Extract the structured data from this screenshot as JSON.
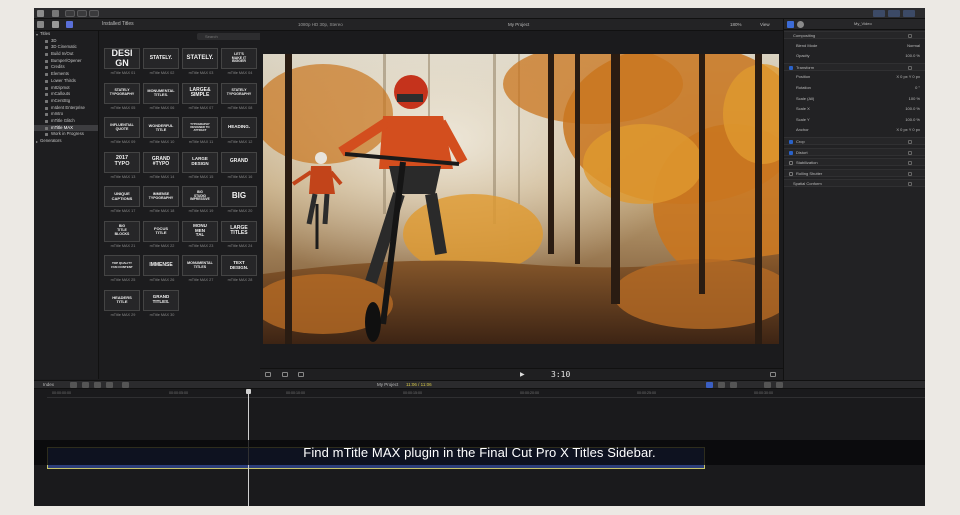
{
  "toolbar": {
    "icons": [
      "film-strip-icon",
      "key-icon",
      "titles-icon",
      "share-icon"
    ]
  },
  "browser": {
    "library_title": "Installed Titles",
    "search_placeholder": "Search",
    "sidebar": [
      {
        "label": "Titles",
        "expanded": true,
        "selected": false
      },
      {
        "label": "3D",
        "selected": false
      },
      {
        "label": "3D Cinematic",
        "selected": false
      },
      {
        "label": "Build In/Out",
        "selected": false
      },
      {
        "label": "Bumper/Opener",
        "selected": false
      },
      {
        "label": "Credits",
        "selected": false
      },
      {
        "label": "Elements",
        "selected": false
      },
      {
        "label": "Lower Thirds",
        "selected": false
      },
      {
        "label": "m8zipmot",
        "selected": false
      },
      {
        "label": "mCallouts",
        "selected": false
      },
      {
        "label": "mCentStg",
        "selected": false
      },
      {
        "label": "mIdent Enterprise",
        "selected": false
      },
      {
        "label": "mIntro",
        "selected": false
      },
      {
        "label": "mTitle Glitch",
        "selected": false
      },
      {
        "label": "mTitle MAX",
        "selected": true
      },
      {
        "label": "Work in Progress",
        "selected": false
      },
      {
        "label": "Generators",
        "expanded": false,
        "selected": false
      }
    ],
    "titles": [
      {
        "thumb": "DESI\nGN",
        "caption": "mTitle MAX 01"
      },
      {
        "thumb": "STATELY.",
        "caption": "mTitle MAX 02"
      },
      {
        "thumb": "STATELY.",
        "caption": "mTitle MAX 03"
      },
      {
        "thumb": "LET'S\nMAKE IT\nBIGGER",
        "caption": "mTitle MAX 04"
      },
      {
        "thumb": "STATELY\nTYPOGRAPHY",
        "caption": "mTitle MAX 05"
      },
      {
        "thumb": "MONUMENTAL\nTITLES.",
        "caption": "mTitle MAX 06"
      },
      {
        "thumb": "LARGE&\nSIMPLE",
        "caption": "mTitle MAX 07"
      },
      {
        "thumb": "STATELY\nTYPOGRAPHY",
        "caption": "mTitle MAX 08"
      },
      {
        "thumb": "INFLUENTIAL\nQUOTE",
        "caption": "mTitle MAX 09"
      },
      {
        "thumb": "WONDERFUL\nTITLE",
        "caption": "mTitle MAX 10"
      },
      {
        "thumb": "TYPOGRAPHY\nDESIGNED TO\nATTRACT",
        "caption": "mTitle MAX 11"
      },
      {
        "thumb": "HEADING.",
        "caption": "mTitle MAX 12"
      },
      {
        "thumb": "2017\nTYPO",
        "caption": "mTitle MAX 13"
      },
      {
        "thumb": "GRAND\n#TYPO",
        "caption": "mTitle MAX 14"
      },
      {
        "thumb": "LARGE\nDESIGN",
        "caption": "mTitle MAX 15"
      },
      {
        "thumb": "GRAND",
        "caption": "mTitle MAX 16"
      },
      {
        "thumb": "UNIQUE\nCAPTIONS",
        "caption": "mTitle MAX 17"
      },
      {
        "thumb": "IMMENSE\nTYPOGRAPHY",
        "caption": "mTitle MAX 18"
      },
      {
        "thumb": "BIG\nSTUDIO\nIMPRESSIVE",
        "caption": "mTitle MAX 19"
      },
      {
        "thumb": "BIG",
        "caption": "mTitle MAX 20"
      },
      {
        "thumb": "BIG\nTITLE\nBLOCKS",
        "caption": "mTitle MAX 21"
      },
      {
        "thumb": "FOCUS\nTITLE",
        "caption": "mTitle MAX 22"
      },
      {
        "thumb": "MONU\nMEN\nTAL",
        "caption": "mTitle MAX 23"
      },
      {
        "thumb": "LARGE\nTITLES",
        "caption": "mTitle MAX 24"
      },
      {
        "thumb": "TOP QUALITY\nFUN CONTENT",
        "caption": "mTitle MAX 25"
      },
      {
        "thumb": "IMMENSE",
        "caption": "mTitle MAX 26"
      },
      {
        "thumb": "MONUMENTAL\nTITLES",
        "caption": "mTitle MAX 27"
      },
      {
        "thumb": "TEXT\nDESIGN.",
        "caption": "mTitle MAX 28"
      },
      {
        "thumb": "HEADERS\nTITLE",
        "caption": "mTitle MAX 29"
      },
      {
        "thumb": "GRAND\nTITLES.",
        "caption": "mTitle MAX 30"
      }
    ]
  },
  "viewer": {
    "format": "1080p HD 30p, Stereo",
    "project": "My Project",
    "zoom": "180%",
    "view_label": "View",
    "timecode": "3:10"
  },
  "inspector": {
    "clip_name": "My_Video",
    "rows": [
      {
        "label": "Compositing",
        "section": true,
        "checked": null,
        "value": ""
      },
      {
        "label": "Blend Mode",
        "section": false,
        "checked": null,
        "value": "Normal"
      },
      {
        "label": "Opacity",
        "section": false,
        "checked": null,
        "value": "100.0 %"
      },
      {
        "label": "Transform",
        "section": true,
        "checked": true,
        "value": ""
      },
      {
        "label": "Position",
        "section": false,
        "checked": null,
        "value": "X  0 px   Y  0 px"
      },
      {
        "label": "Rotation",
        "section": false,
        "checked": null,
        "value": "0 °"
      },
      {
        "label": "Scale (All)",
        "section": false,
        "checked": null,
        "value": "100 %"
      },
      {
        "label": "Scale X",
        "section": false,
        "checked": null,
        "value": "100.0 %"
      },
      {
        "label": "Scale Y",
        "section": false,
        "checked": null,
        "value": "100.0 %"
      },
      {
        "label": "Anchor",
        "section": false,
        "checked": null,
        "value": "X  0 px   Y  0 px"
      },
      {
        "label": "Crop",
        "section": true,
        "checked": true,
        "value": ""
      },
      {
        "label": "Distort",
        "section": true,
        "checked": true,
        "value": ""
      },
      {
        "label": "Stabilization",
        "section": true,
        "checked": false,
        "value": ""
      },
      {
        "label": "Rolling Shutter",
        "section": true,
        "checked": false,
        "value": ""
      },
      {
        "label": "Spatial Conform",
        "section": true,
        "checked": null,
        "value": ""
      }
    ]
  },
  "timeline": {
    "index_label": "Index",
    "project_label": "My Project",
    "duration": "11:06 / 11:06",
    "ruler_ticks": [
      "00:00:00:00",
      "00:00:05:00",
      "00:00:10:00",
      "00:00:15:00",
      "00:00:20:00",
      "00:00:25:00",
      "00:00:30:00"
    ]
  },
  "subtitle": "Find mTitle MAX plugin in the Final Cut Pro X Titles Sidebar.",
  "colors": {
    "accent": "#2a62c9",
    "clip_fill": "#2c3e7a",
    "clip_border": "#c7c46a",
    "timecode_yellow": "#d8c94a"
  }
}
